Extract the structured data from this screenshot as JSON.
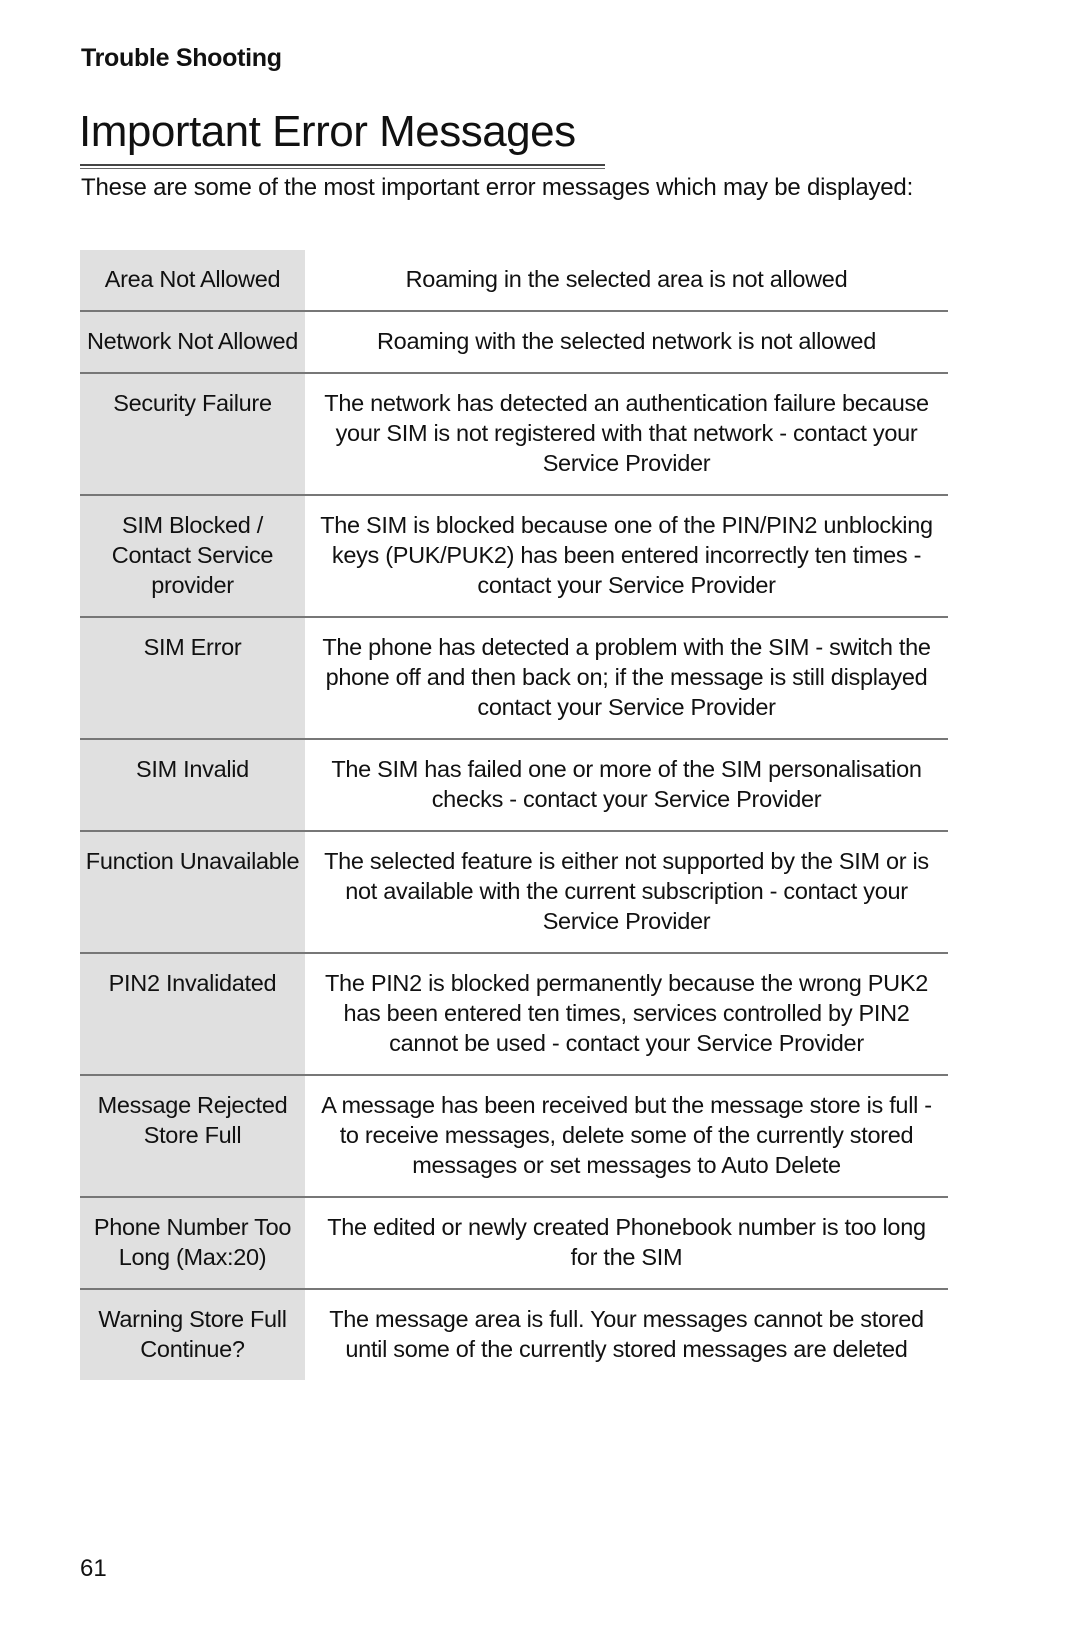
{
  "header": {
    "section": "Trouble Shooting",
    "title": "Important Error Messages",
    "intro": "These are some of the most important error messages which may be displayed:"
  },
  "error_table": {
    "rows": [
      {
        "message": "Area Not Allowed",
        "description": "Roaming in the selected area is not allowed"
      },
      {
        "message": "Network Not Allowed",
        "description": "Roaming with the selected network is not allowed"
      },
      {
        "message": "Security Failure",
        "description": "The network has detected an authentication failure because your SIM is not registered with that network - contact your Service Provider"
      },
      {
        "message": "SIM Blocked / Contact Service provider",
        "description": "The SIM is blocked because one of the PIN/PIN2 unblocking keys (PUK/PUK2) has been entered incorrectly ten times - contact your Service Provider"
      },
      {
        "message": "SIM Error",
        "description": "The phone has detected a problem with the SIM - switch the phone off and then back on; if the message is still displayed contact your Service Provider"
      },
      {
        "message": "SIM Invalid",
        "description": "The SIM has failed one or more of the SIM personalisation checks - contact your Service Provider"
      },
      {
        "message": "Function Unavailable",
        "description": "The selected feature is either not supported by the SIM or is not available with the current subscription - contact your Service Provider"
      },
      {
        "message": "PIN2 Invalidated",
        "description": "The PIN2 is blocked permanently because the wrong PUK2 has been entered ten times, services controlled by PIN2 cannot be used - contact your Service Provider"
      },
      {
        "message": "Message Rejected Store Full",
        "description": "A message has been received but the message store is full - to receive messages, delete some of the currently stored messages or set messages to Auto Delete"
      },
      {
        "message": "Phone Number Too Long (Max:20)",
        "description": "The edited or newly created Phonebook number is too long for the SIM"
      },
      {
        "message": "Warning Store Full Continue?",
        "description": "The message area is full. Your messages cannot be stored until some of the currently stored messages are deleted"
      }
    ]
  },
  "footer": {
    "page_number": "61"
  },
  "colors": {
    "key_column_bg": "#e0e0e0",
    "row_divider": "#777777",
    "text": "#111111"
  }
}
